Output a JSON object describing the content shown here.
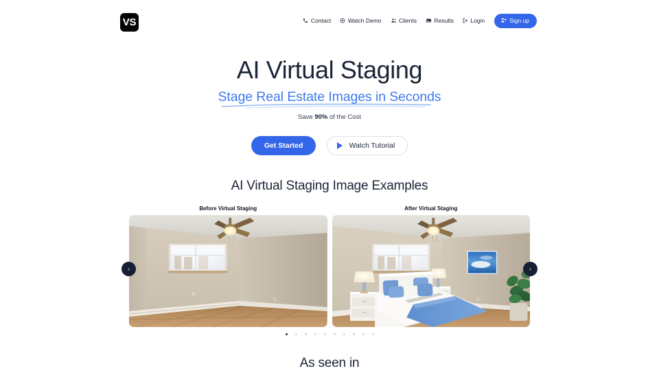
{
  "brand": {
    "logo_text": "VS"
  },
  "nav": {
    "items": [
      {
        "label": "Contact",
        "icon": "phone-icon"
      },
      {
        "label": "Watch Demo",
        "icon": "play-circle-icon"
      },
      {
        "label": "Clients",
        "icon": "users-icon"
      },
      {
        "label": "Results",
        "icon": "image-icon"
      },
      {
        "label": "Login",
        "icon": "login-icon"
      }
    ],
    "signup": {
      "label": "Sign up",
      "icon": "user-plus-icon"
    }
  },
  "hero": {
    "title": "AI Virtual Staging",
    "subtitle": "Stage Real Estate Images in Seconds",
    "note_prefix": "Save ",
    "note_strong": "90%",
    "note_suffix": " of the Cost",
    "primary_cta": "Get Started",
    "secondary_cta": "Watch Tutorial"
  },
  "examples": {
    "heading": "AI Virtual Staging Image Examples",
    "before_label": "Before Virtual Staging",
    "after_label": "After Virtual Staging",
    "prev_arrow": "‹",
    "next_arrow": "›",
    "dot_count": 10,
    "active_dot": 0
  },
  "as_seen_in": {
    "heading": "As seen in"
  },
  "colors": {
    "accent_blue": "#3366e8",
    "subtitle_blue": "#3f79ef",
    "dark_navy": "#1b2437",
    "arrow_bg": "#161f33"
  }
}
